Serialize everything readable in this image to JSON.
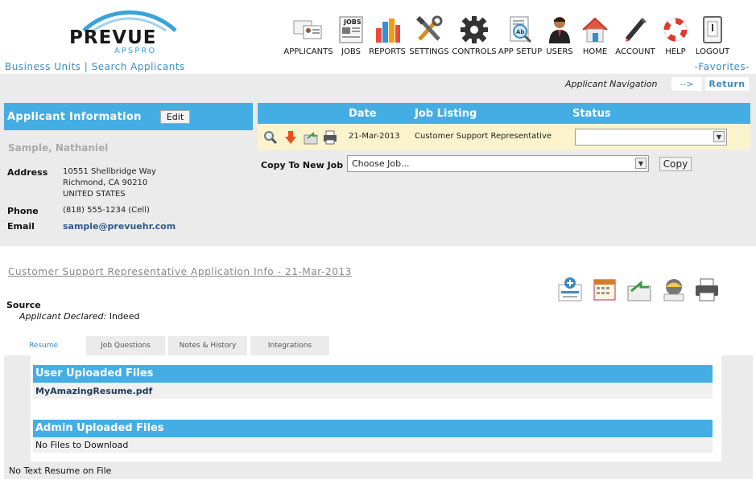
{
  "brand": {
    "name": "PREVUE",
    "sub": "APSPRO",
    "tm": "™"
  },
  "nav": [
    {
      "label": "APPLICANTS",
      "icon": "applicants-icon"
    },
    {
      "label": "JOBS",
      "icon": "jobs-icon"
    },
    {
      "label": "REPORTS",
      "icon": "reports-icon"
    },
    {
      "label": "SETTINGS",
      "icon": "settings-icon"
    },
    {
      "label": "CONTROLS",
      "icon": "controls-icon"
    },
    {
      "label": "APP SETUP",
      "icon": "app-setup-icon"
    },
    {
      "label": "USERS",
      "icon": "users-icon"
    },
    {
      "label": "HOME",
      "icon": "home-icon"
    },
    {
      "label": "ACCOUNT",
      "icon": "account-icon"
    },
    {
      "label": "HELP",
      "icon": "help-icon"
    },
    {
      "label": "LOGOUT",
      "icon": "logout-icon"
    }
  ],
  "links": {
    "business_units": "Business Units",
    "separator": "|",
    "search_applicants": "Search Applicants",
    "favorites": "-Favorites-"
  },
  "applicant_nav": {
    "label": "Applicant Navigation",
    "arrow": "-->",
    "return": "Return"
  },
  "applicant": {
    "header": "Applicant Information",
    "edit": "Edit",
    "name": "Sample, Nathaniel",
    "address_label": "Address",
    "address_lines": [
      "10551 Shellbridge Way",
      "Richmond, CA 90210",
      "UNITED STATES"
    ],
    "phone_label": "Phone",
    "phone": "(818) 555-1234 (Cell)",
    "email_label": "Email",
    "email": "sample@prevuehr.com"
  },
  "job_table": {
    "headers": {
      "date": "Date",
      "job_listing": "Job Listing",
      "status": "Status"
    },
    "row": {
      "date": "21-Mar-2013",
      "job": "Customer Support Representative",
      "status": ""
    },
    "copy_label": "Copy To New Job",
    "choose_job": "Choose Job...",
    "copy_button": "Copy"
  },
  "application": {
    "title": "Customer Support Representative Application Info - 21-Mar-2013",
    "source_label": "Source",
    "declared_label": "Applicant Declared:",
    "declared_value": "Indeed"
  },
  "tabs": [
    "Resume",
    "Job Questions",
    "Notes & History",
    "Integrations"
  ],
  "files": {
    "user_header": "User Uploaded Files",
    "user_file": "MyAmazingResume.pdf",
    "admin_header": "Admin Uploaded Files",
    "admin_none": "No Files to Download",
    "no_text_resume": "No Text Resume on File"
  },
  "colors": {
    "accent": "#44aee4",
    "link": "#3a8cc4",
    "panel": "#ebebeb",
    "highlight_row": "#fbf3cc"
  }
}
